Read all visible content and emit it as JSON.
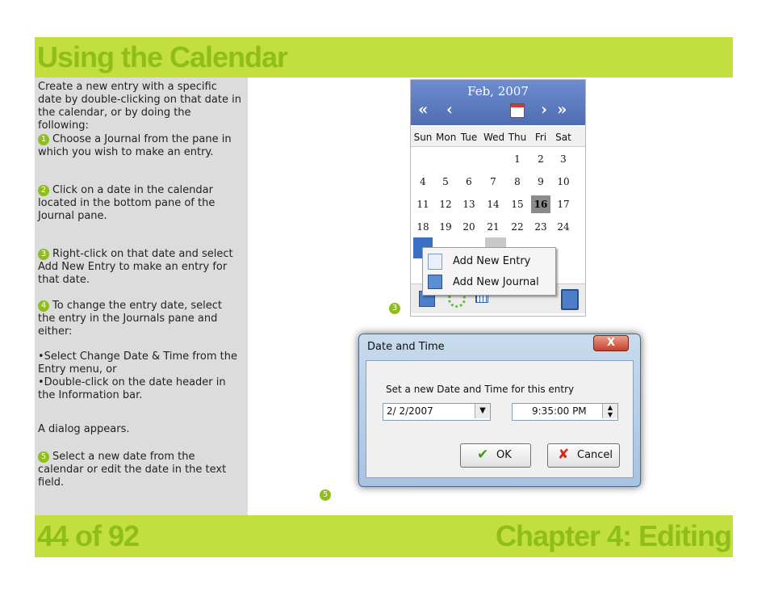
{
  "header": {
    "title": "Using the Calendar"
  },
  "footer": {
    "page": "44 of 92",
    "chapter": "Chapter 4: Editing"
  },
  "colors": {
    "band": "#c2df3f",
    "title": "#8fbe1b",
    "pane": "#dcdcdc"
  },
  "instructions": {
    "intro": "Create a new entry with a specific date by double-clicking on that date in the calendar, or by doing the following:",
    "steps": [
      {
        "num": "1",
        "text": "Choose a Journal from the pane in which you wish to make an entry."
      },
      {
        "num": "2",
        "text": "Click on a date in the calendar located in the bottom pane of the Journal pane."
      },
      {
        "num": "3",
        "text": "Right-click on that date and select Add New Entry to make an entry for that date."
      },
      {
        "num": "4",
        "text": "To change the entry date, select the entry in the Journals pane and either:"
      }
    ],
    "bullets": [
      "Select Change Date & Time from the Entry menu, or",
      "Double-click on the date header in the Information bar."
    ],
    "note": "A dialog appears.",
    "final_step": {
      "num": "5",
      "text": "Select a new date from the calendar or edit the date in the text field."
    }
  },
  "calendar": {
    "month": "Feb, 2007",
    "nav": {
      "prev_year": "«",
      "prev_month": "‹",
      "next_month": "›",
      "next_year": "»"
    },
    "weekdays": [
      "Sun",
      "Mon",
      "Tue",
      "Wed",
      "Thu",
      "Fri",
      "Sat"
    ],
    "weeks": [
      [
        "",
        "",
        "",
        "",
        "1",
        "2",
        "3"
      ],
      [
        "4",
        "5",
        "6",
        "7",
        "8",
        "9",
        "10"
      ],
      [
        "11",
        "12",
        "13",
        "14",
        "15",
        "16",
        "17"
      ],
      [
        "18",
        "19",
        "20",
        "21",
        "22",
        "23",
        "24"
      ]
    ],
    "today": "16",
    "context_menu": [
      "Add New Entry",
      "Add New Journal"
    ],
    "callout": "3"
  },
  "dialog": {
    "title": "Date and Time",
    "close": "X",
    "prompt": "Set a new Date and Time for this entry",
    "date_value": "2/ 2/2007",
    "time_value": "9:35:00 PM",
    "ok": "OK",
    "cancel": "Cancel",
    "callout": "5"
  }
}
